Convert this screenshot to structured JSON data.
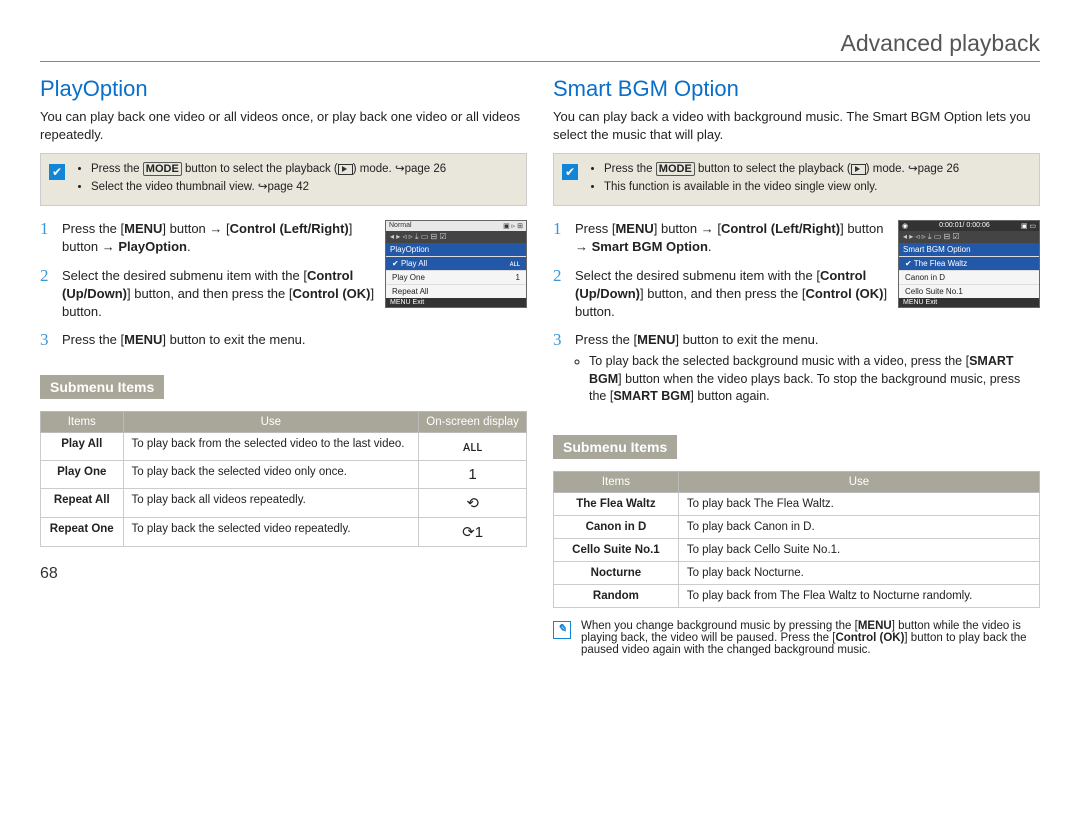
{
  "header": {
    "title": "Advanced playback"
  },
  "page_number": "68",
  "left": {
    "title": "PlayOption",
    "intro": "You can play back one video or all videos once, or play back one video or all videos repeatedly.",
    "pre_note": {
      "line1_pre": "Press the ",
      "line1_btn": "MODE",
      "line1_post": " button to select the playback (",
      "line1_tail": ") mode. ↪page 26",
      "line2": "Select the video thumbnail view. ↪page 42"
    },
    "steps": {
      "s1a": "Press the [",
      "s1b": "MENU",
      "s1c": "] button → [",
      "s1d": "Control (Left/Right)",
      "s1e": "] button → ",
      "s1f": "PlayOption",
      "s1g": ".",
      "s2a": "Select the desired submenu item with the [",
      "s2b": "Control (Up/Down)",
      "s2c": "] button, and then press the [",
      "s2d": "Control (OK)",
      "s2e": "] button.",
      "s3a": "Press the [",
      "s3b": "MENU",
      "s3c": "] button to exit the menu."
    },
    "screenshot": {
      "top_left": "Normal",
      "menu_title": "PlayOption",
      "rows": [
        {
          "label": "Play All",
          "icon": "ᴀʟʟ",
          "sel": true
        },
        {
          "label": "Play One",
          "icon": "1",
          "sel": false
        },
        {
          "label": "Repeat All",
          "icon": "",
          "sel": false
        }
      ],
      "exit": "MENU  Exit"
    },
    "submenu_header": "Submenu Items",
    "table": {
      "h1": "Items",
      "h2": "Use",
      "h3": "On-screen display",
      "rows": [
        {
          "item": "Play All",
          "use": "To play back from the selected video to the last video.",
          "osd": "ᴀʟʟ"
        },
        {
          "item": "Play One",
          "use": "To play back the selected video only once.",
          "osd": "1"
        },
        {
          "item": "Repeat All",
          "use": "To play back all videos repeatedly.",
          "osd": "⟲"
        },
        {
          "item": "Repeat One",
          "use": "To play back the selected video repeatedly.",
          "osd": "⟳1"
        }
      ]
    }
  },
  "right": {
    "title": "Smart BGM Option",
    "intro": "You can play back a video with background music. The Smart BGM Option lets you select the music that will play.",
    "pre_note": {
      "line1_pre": "Press the ",
      "line1_btn": "MODE",
      "line1_post": " button to select the playback (",
      "line1_tail": ") mode. ↪page 26",
      "line2": "This function is available in the video single view only."
    },
    "steps": {
      "s1a": "Press [",
      "s1b": "MENU",
      "s1c": "] button → [",
      "s1d": "Control (Left/Right)",
      "s1e": "] button → ",
      "s1f": "Smart BGM Option",
      "s1g": ".",
      "s2a": "Select the desired submenu item with the [",
      "s2b": "Control (Up/Down)",
      "s2c": "] button, and then press the [",
      "s2d": "Control (OK)",
      "s2e": "] button.",
      "s3a": "Press the [",
      "s3b": "MENU",
      "s3c": "] button to exit the menu.",
      "b1a": "To play back the selected background music with a video, press the [",
      "b1b": "SMART BGM",
      "b1c": "] button when the video plays back. To stop the background music, press the [",
      "b1d": "SMART BGM",
      "b1e": "] button again."
    },
    "screenshot": {
      "time": "0:00:01/ 0:00:06",
      "menu_title": "Smart BGM Option",
      "rows": [
        {
          "label": "The Flea Waltz",
          "sel": true
        },
        {
          "label": "Canon in D",
          "sel": false
        },
        {
          "label": "Cello Suite No.1",
          "sel": false
        }
      ],
      "exit": "MENU  Exit"
    },
    "submenu_header": "Submenu Items",
    "table": {
      "h1": "Items",
      "h2": "Use",
      "rows": [
        {
          "item": "The Flea Waltz",
          "use": "To play back The Flea Waltz."
        },
        {
          "item": "Canon in D",
          "use": "To play back Canon in D."
        },
        {
          "item": "Cello Suite No.1",
          "use": "To play back Cello Suite No.1."
        },
        {
          "item": "Nocturne",
          "use": "To play back Nocturne."
        },
        {
          "item": "Random",
          "use": "To play back from The Flea Waltz to Nocturne randomly."
        }
      ]
    },
    "note": {
      "a": "When you change background music by pressing the [",
      "b": "MENU",
      "c": "] button while the video is playing back, the video will be paused. Press the [",
      "d": "Control (OK)",
      "e": "] button to play back the paused video again with the changed background music."
    }
  }
}
